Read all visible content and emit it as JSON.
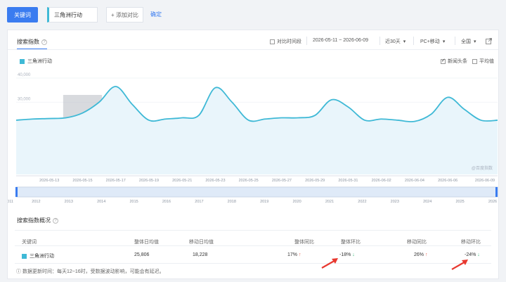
{
  "toolbar": {
    "keyword_button": "关键词",
    "keyword_value": "三角洲行动",
    "add_compare": "+ 添加对比",
    "confirm": "确定"
  },
  "card": {
    "title": "搜索指数",
    "compare_period": "对比时间段",
    "date_range": "2026-05-11 ~ 2026-06-09",
    "period_select": "近30天",
    "platform_select": "PC+移动",
    "region_select": "全国",
    "legend_label": "三角洲行动",
    "news_label": "新闻头条",
    "average_label": "平均值",
    "watermark": "@百度指数"
  },
  "chart_data": {
    "type": "area",
    "title": "",
    "xlabel": "",
    "ylabel": "",
    "ylim": [
      0,
      40000
    ],
    "yticks": [
      "40,000",
      "30,000",
      "20,000",
      "10,000"
    ],
    "x_ticks": [
      "2026-05-13",
      "2026-05-15",
      "2026-05-17",
      "2026-05-19",
      "2026-05-21",
      "2026-05-23",
      "2026-05-25",
      "2026-05-27",
      "2026-05-29",
      "2026-05-31",
      "2026-06-02",
      "2026-06-04",
      "2026-06-06",
      "2026-06-09"
    ],
    "series": [
      {
        "name": "三角洲行动",
        "x": [
          "2026-05-11",
          "2026-05-12",
          "2026-05-13",
          "2026-05-14",
          "2026-05-15",
          "2026-05-16",
          "2026-05-17",
          "2026-05-18",
          "2026-05-19",
          "2026-05-20",
          "2026-05-21",
          "2026-05-22",
          "2026-05-23",
          "2026-05-24",
          "2026-05-25",
          "2026-05-26",
          "2026-05-27",
          "2026-05-28",
          "2026-05-29",
          "2026-05-30",
          "2026-05-31",
          "2026-06-01",
          "2026-06-02",
          "2026-06-03",
          "2026-06-04",
          "2026-06-05",
          "2026-06-06",
          "2026-06-07",
          "2026-06-08",
          "2026-06-09"
        ],
        "values": [
          22500,
          23000,
          23200,
          23500,
          25500,
          30000,
          36500,
          29000,
          22500,
          23000,
          23500,
          24500,
          36000,
          30000,
          22500,
          23000,
          23500,
          23500,
          24500,
          31000,
          28000,
          22500,
          23000,
          22500,
          22000,
          25000,
          32000,
          27000,
          22500,
          22500
        ]
      }
    ],
    "highlight_range": [
      "2026-05-14",
      "2026-05-16"
    ],
    "overview_years": [
      "2011",
      "2012",
      "2013",
      "2014",
      "2015",
      "2016",
      "2017",
      "2018",
      "2019",
      "2020",
      "2021",
      "2022",
      "2023",
      "2024",
      "2025",
      "2026"
    ]
  },
  "summary": {
    "title": "搜索指数概况",
    "headers": [
      "关键词",
      "整体日均值",
      "移动日均值",
      "整体同比",
      "整体环比",
      "移动同比",
      "移动环比"
    ],
    "row": {
      "keyword": "三角洲行动",
      "overall_avg": "25,806",
      "mobile_avg": "18,228",
      "overall_yoy": "17%",
      "overall_mom": "-18%",
      "mobile_yoy": "26%",
      "mobile_mom": "-24%"
    },
    "note": "ⓘ 数据更新时间：每天12~16时，受数据波动影响，可能会有延迟。"
  },
  "colors": {
    "accent": "#3a7cf0",
    "series": "#3fb9d6",
    "arrow": "#e8382f",
    "up": "#e85b4a",
    "down": "#2bb673"
  }
}
